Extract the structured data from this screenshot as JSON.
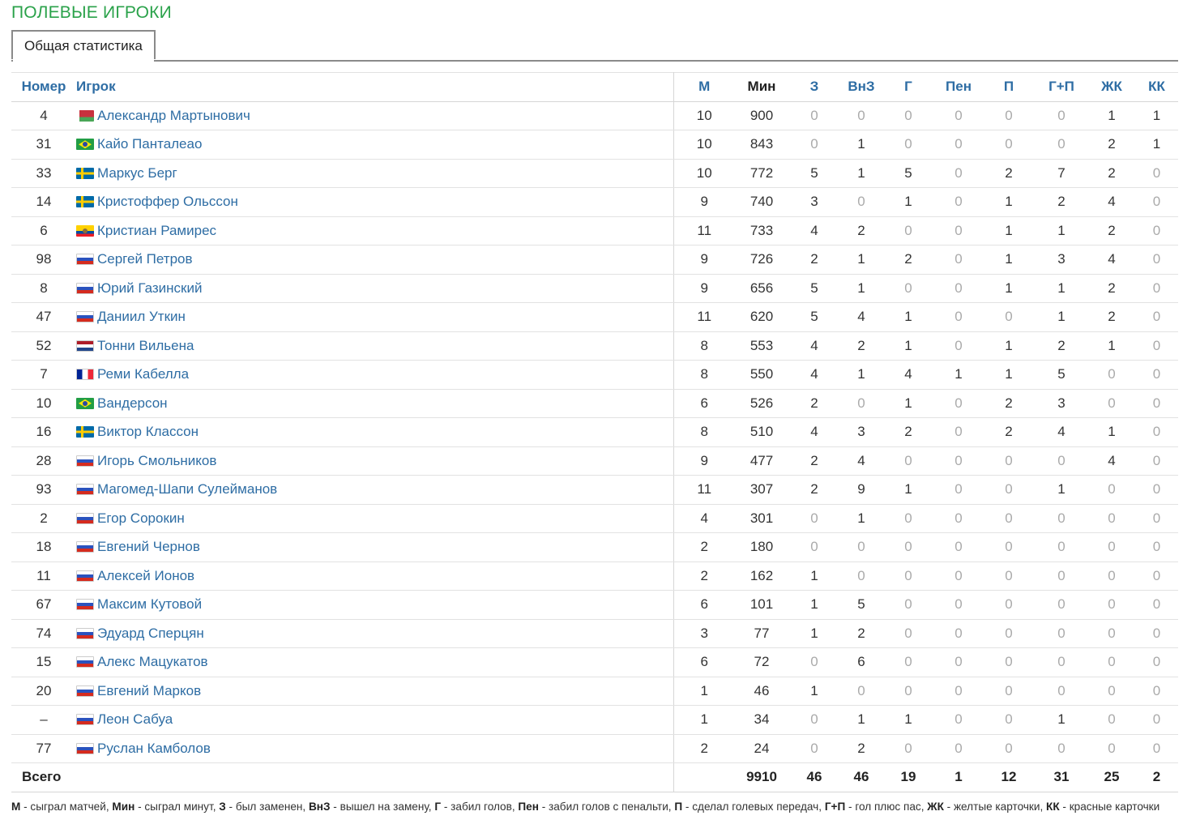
{
  "section_title": "ПОЛЕВЫЕ ИГРОКИ",
  "tab_label": "Общая статистика",
  "columns": {
    "number": "Номер",
    "player": "Игрок",
    "m": "М",
    "min": "Мин",
    "z": "З",
    "vnz": "ВнЗ",
    "g": "Г",
    "pen": "Пен",
    "p": "П",
    "gp": "Г+П",
    "zhk": "ЖК",
    "kk": "КК"
  },
  "rows": [
    {
      "number": "4",
      "flag": "by",
      "name": "Александр Мартынович",
      "m": "10",
      "min": "900",
      "z": "0",
      "vnz": "0",
      "g": "0",
      "pen": "0",
      "p": "0",
      "gp": "0",
      "zhk": "1",
      "kk": "1"
    },
    {
      "number": "31",
      "flag": "br",
      "name": "Кайо Панталеао",
      "m": "10",
      "min": "843",
      "z": "0",
      "vnz": "1",
      "g": "0",
      "pen": "0",
      "p": "0",
      "gp": "0",
      "zhk": "2",
      "kk": "1"
    },
    {
      "number": "33",
      "flag": "se",
      "name": "Маркус Берг",
      "m": "10",
      "min": "772",
      "z": "5",
      "vnz": "1",
      "g": "5",
      "pen": "0",
      "p": "2",
      "gp": "7",
      "zhk": "2",
      "kk": "0"
    },
    {
      "number": "14",
      "flag": "se",
      "name": "Кристоффер Ольссон",
      "m": "9",
      "min": "740",
      "z": "3",
      "vnz": "0",
      "g": "1",
      "pen": "0",
      "p": "1",
      "gp": "2",
      "zhk": "4",
      "kk": "0"
    },
    {
      "number": "6",
      "flag": "ec",
      "name": "Кристиан Рамирес",
      "m": "11",
      "min": "733",
      "z": "4",
      "vnz": "2",
      "g": "0",
      "pen": "0",
      "p": "1",
      "gp": "1",
      "zhk": "2",
      "kk": "0"
    },
    {
      "number": "98",
      "flag": "ru",
      "name": "Сергей Петров",
      "m": "9",
      "min": "726",
      "z": "2",
      "vnz": "1",
      "g": "2",
      "pen": "0",
      "p": "1",
      "gp": "3",
      "zhk": "4",
      "kk": "0"
    },
    {
      "number": "8",
      "flag": "ru",
      "name": "Юрий Газинский",
      "m": "9",
      "min": "656",
      "z": "5",
      "vnz": "1",
      "g": "0",
      "pen": "0",
      "p": "1",
      "gp": "1",
      "zhk": "2",
      "kk": "0"
    },
    {
      "number": "47",
      "flag": "ru",
      "name": "Даниил Уткин",
      "m": "11",
      "min": "620",
      "z": "5",
      "vnz": "4",
      "g": "1",
      "pen": "0",
      "p": "0",
      "gp": "1",
      "zhk": "2",
      "kk": "0"
    },
    {
      "number": "52",
      "flag": "nl",
      "name": "Тонни Вильена",
      "m": "8",
      "min": "553",
      "z": "4",
      "vnz": "2",
      "g": "1",
      "pen": "0",
      "p": "1",
      "gp": "2",
      "zhk": "1",
      "kk": "0"
    },
    {
      "number": "7",
      "flag": "fr",
      "name": "Реми Кабелла",
      "m": "8",
      "min": "550",
      "z": "4",
      "vnz": "1",
      "g": "4",
      "pen": "1",
      "p": "1",
      "gp": "5",
      "zhk": "0",
      "kk": "0"
    },
    {
      "number": "10",
      "flag": "br",
      "name": "Вандерсон",
      "m": "6",
      "min": "526",
      "z": "2",
      "vnz": "0",
      "g": "1",
      "pen": "0",
      "p": "2",
      "gp": "3",
      "zhk": "0",
      "kk": "0"
    },
    {
      "number": "16",
      "flag": "se",
      "name": "Виктор Классон",
      "m": "8",
      "min": "510",
      "z": "4",
      "vnz": "3",
      "g": "2",
      "pen": "0",
      "p": "2",
      "gp": "4",
      "zhk": "1",
      "kk": "0"
    },
    {
      "number": "28",
      "flag": "ru",
      "name": "Игорь Смольников",
      "m": "9",
      "min": "477",
      "z": "2",
      "vnz": "4",
      "g": "0",
      "pen": "0",
      "p": "0",
      "gp": "0",
      "zhk": "4",
      "kk": "0"
    },
    {
      "number": "93",
      "flag": "ru",
      "name": "Магомед-Шапи Сулейманов",
      "m": "11",
      "min": "307",
      "z": "2",
      "vnz": "9",
      "g": "1",
      "pen": "0",
      "p": "0",
      "gp": "1",
      "zhk": "0",
      "kk": "0"
    },
    {
      "number": "2",
      "flag": "ru",
      "name": "Егор Сорокин",
      "m": "4",
      "min": "301",
      "z": "0",
      "vnz": "1",
      "g": "0",
      "pen": "0",
      "p": "0",
      "gp": "0",
      "zhk": "0",
      "kk": "0"
    },
    {
      "number": "18",
      "flag": "ru",
      "name": "Евгений Чернов",
      "m": "2",
      "min": "180",
      "z": "0",
      "vnz": "0",
      "g": "0",
      "pen": "0",
      "p": "0",
      "gp": "0",
      "zhk": "0",
      "kk": "0"
    },
    {
      "number": "11",
      "flag": "ru",
      "name": "Алексей Ионов",
      "m": "2",
      "min": "162",
      "z": "1",
      "vnz": "0",
      "g": "0",
      "pen": "0",
      "p": "0",
      "gp": "0",
      "zhk": "0",
      "kk": "0"
    },
    {
      "number": "67",
      "flag": "ru",
      "name": "Максим Кутовой",
      "m": "6",
      "min": "101",
      "z": "1",
      "vnz": "5",
      "g": "0",
      "pen": "0",
      "p": "0",
      "gp": "0",
      "zhk": "0",
      "kk": "0"
    },
    {
      "number": "74",
      "flag": "ru",
      "name": "Эдуард Сперцян",
      "m": "3",
      "min": "77",
      "z": "1",
      "vnz": "2",
      "g": "0",
      "pen": "0",
      "p": "0",
      "gp": "0",
      "zhk": "0",
      "kk": "0"
    },
    {
      "number": "15",
      "flag": "ru",
      "name": "Алекс Мацукатов",
      "m": "6",
      "min": "72",
      "z": "0",
      "vnz": "6",
      "g": "0",
      "pen": "0",
      "p": "0",
      "gp": "0",
      "zhk": "0",
      "kk": "0"
    },
    {
      "number": "20",
      "flag": "ru",
      "name": "Евгений Марков",
      "m": "1",
      "min": "46",
      "z": "1",
      "vnz": "0",
      "g": "0",
      "pen": "0",
      "p": "0",
      "gp": "0",
      "zhk": "0",
      "kk": "0"
    },
    {
      "number": "–",
      "flag": "ru",
      "name": "Леон Сабуа",
      "m": "1",
      "min": "34",
      "z": "0",
      "vnz": "1",
      "g": "1",
      "pen": "0",
      "p": "0",
      "gp": "1",
      "zhk": "0",
      "kk": "0"
    },
    {
      "number": "77",
      "flag": "ru",
      "name": "Руслан Камболов",
      "m": "2",
      "min": "24",
      "z": "0",
      "vnz": "2",
      "g": "0",
      "pen": "0",
      "p": "0",
      "gp": "0",
      "zhk": "0",
      "kk": "0"
    }
  ],
  "total": {
    "label": "Всего",
    "min": "9910",
    "z": "46",
    "vnz": "46",
    "g": "19",
    "pen": "1",
    "p": "12",
    "gp": "31",
    "zhk": "25",
    "kk": "2"
  },
  "legend": [
    {
      "abbr": "М",
      "text": " - сыграл матчей, "
    },
    {
      "abbr": "Мин",
      "text": " - сыграл минут, "
    },
    {
      "abbr": "З",
      "text": " - был заменен, "
    },
    {
      "abbr": "ВнЗ",
      "text": " - вышел на замену, "
    },
    {
      "abbr": "Г",
      "text": " - забил голов, "
    },
    {
      "abbr": "Пен",
      "text": " - забил голов с пенальти, "
    },
    {
      "abbr": "П",
      "text": " - сделал голевых передач, "
    },
    {
      "abbr": "Г+П",
      "text": " - гол плюс пас, "
    },
    {
      "abbr": "ЖК",
      "text": " - желтые карточки, "
    },
    {
      "abbr": "КК",
      "text": " - красные карточки"
    }
  ],
  "colors": {
    "title_green": "#2aa24a",
    "link_blue": "#2e6da4",
    "zero_grey": "#aaaaaa"
  },
  "flag_icons": {
    "by": "belarus-flag-icon",
    "br": "brazil-flag-icon",
    "se": "sweden-flag-icon",
    "ec": "ecuador-flag-icon",
    "ru": "russia-flag-icon",
    "nl": "netherlands-flag-icon",
    "fr": "france-flag-icon"
  }
}
